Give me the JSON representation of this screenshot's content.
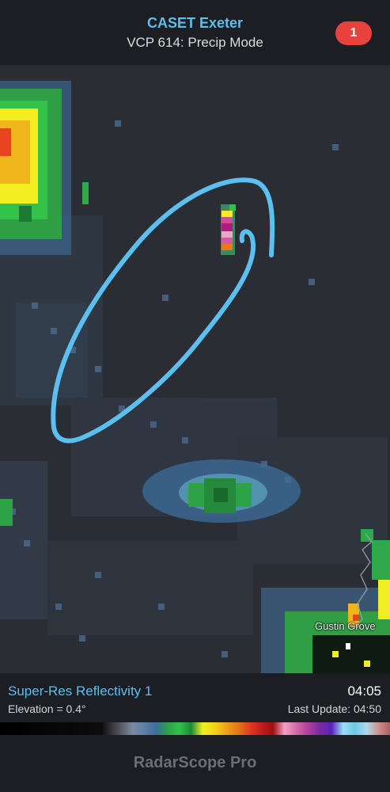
{
  "header": {
    "title": "CASET Exeter",
    "subtitle": "VCP 614: Precip Mode",
    "badge_count": "1"
  },
  "map": {
    "city_label": "Gustin Grove",
    "annotation_color": "#5bc0f0"
  },
  "info": {
    "product": "Super-Res Reflectivity 1",
    "scan_time": "04:05",
    "elevation": "Elevation = 0.4°",
    "last_update": "Last Update: 04:50"
  },
  "footer": {
    "app_name": "RadarScope Pro"
  },
  "colors": {
    "accent": "#5bc0f0",
    "badge": "#e8423f"
  }
}
